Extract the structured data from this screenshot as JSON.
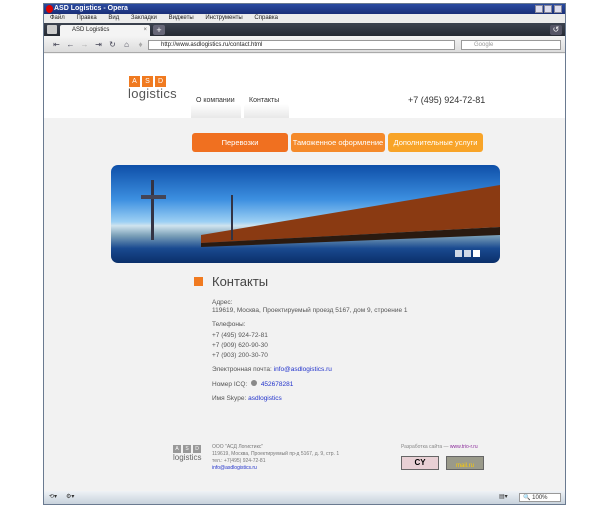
{
  "browser": {
    "title": "ASD Logistics - Opera",
    "menu": [
      "Файл",
      "Правка",
      "Вид",
      "Закладки",
      "Виджеты",
      "Инструменты",
      "Справка"
    ],
    "tab_title": "ASD Logistics",
    "url": "http://www.asdlogistics.ru/contact.html",
    "search_placeholder": "Google",
    "zoom": "100%"
  },
  "site": {
    "logo": {
      "letters": [
        "A",
        "S",
        "D"
      ],
      "word": "logistics"
    },
    "nav": [
      "О компании",
      "Контакты"
    ],
    "phone": "+7 (495) 924-72-81",
    "buttons": [
      "Перевозки",
      "Таможенное оформление",
      "Дополнительные услуги"
    ],
    "colors": {
      "orange1": "#f07020",
      "orange2": "#f58a2a",
      "orange3": "#f8a428",
      "accent": "#f07a20"
    },
    "contacts": {
      "heading": "Контакты",
      "address_label": "Адрес:",
      "address": "119619, Москва, Проектируемый проезд 5167, дом 9, строение 1",
      "phones_label": "Телефоны:",
      "phones": [
        "+7 (495) 924-72-81",
        "+7 (909) 620-90-30",
        "+7 (903) 200-30-70"
      ],
      "email_label": "Электронная почта:",
      "email": "info@asdlogistics.ru",
      "icq_label": "Номер ICQ:",
      "icq": "452678281",
      "skype_label": "Имя Skype:",
      "skype": "asdlogistics"
    },
    "footer": {
      "company": "ООО \"АСД Логистикс\"",
      "address": "119619, Москва, Проектируемый пр-д 5167, д. 9, стр. 1",
      "phone": "тел.: +7(495) 924-72-81",
      "email": "info@asdlogistics.ru",
      "dev_label": "Разработка сайта —",
      "dev_link": "www.trio-r.ru",
      "badge1": "CY",
      "badge2": "mail.ru"
    }
  }
}
